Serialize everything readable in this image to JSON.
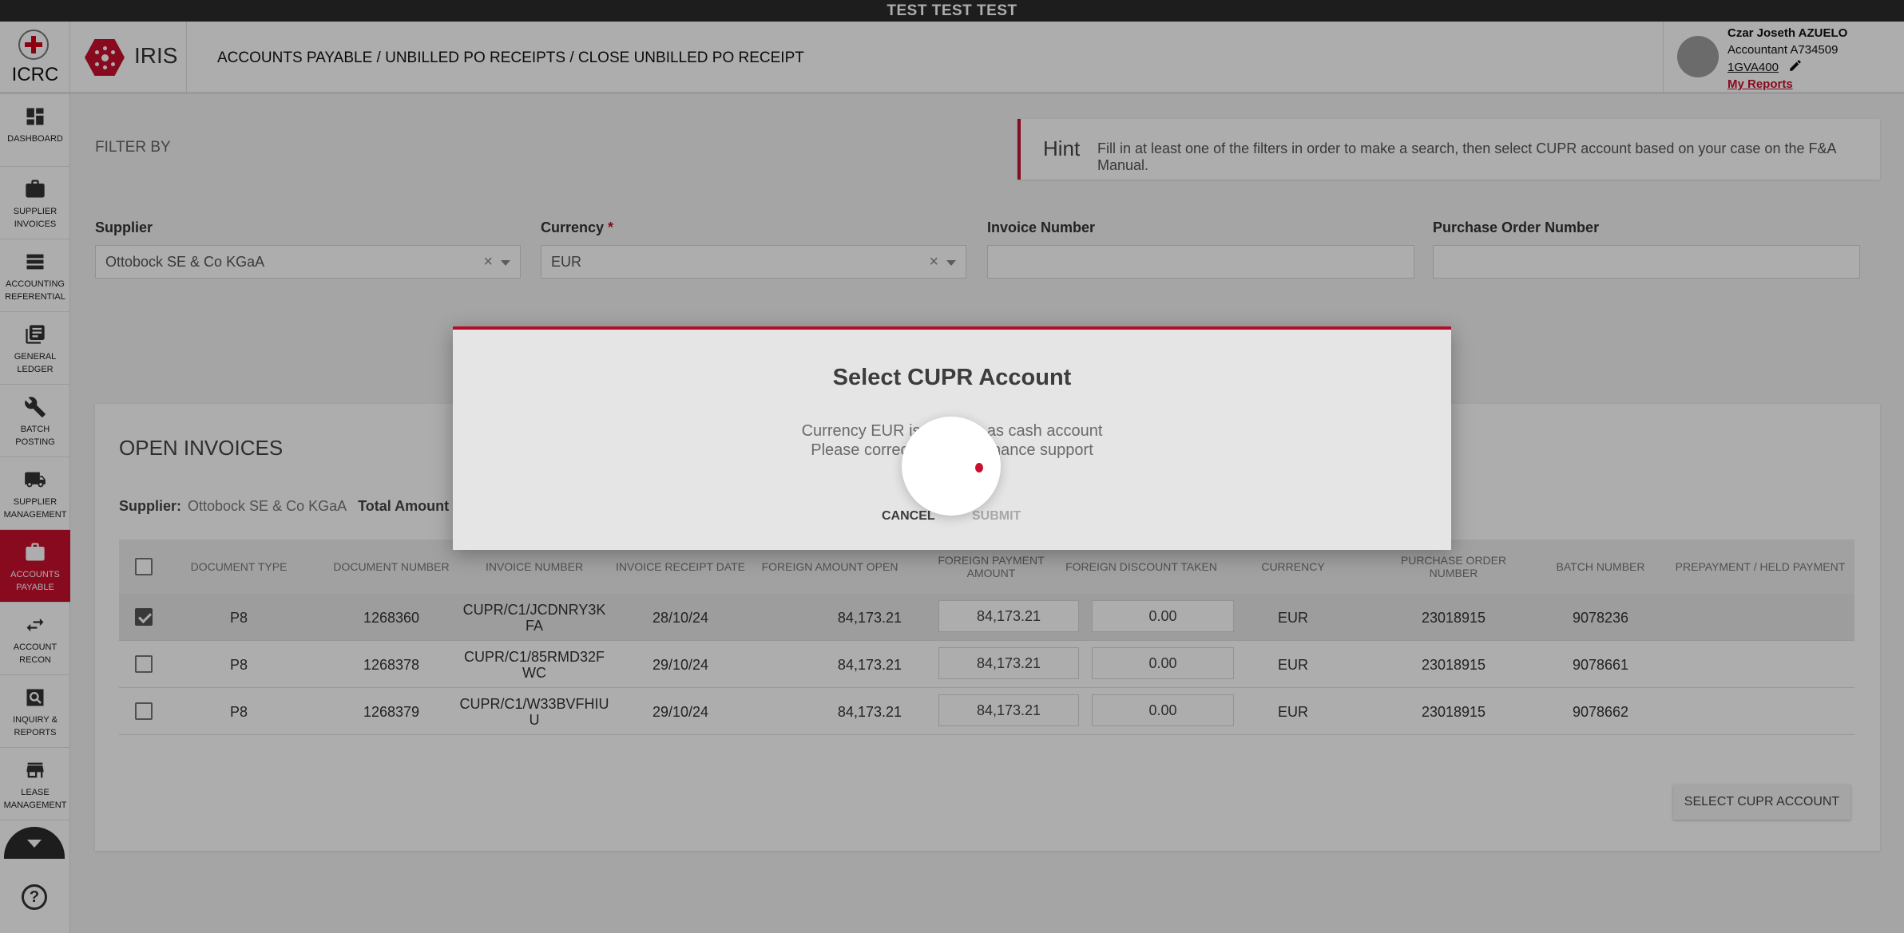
{
  "env_banner": "TEST TEST TEST",
  "header": {
    "logo_text": "ICRC",
    "app_name": "IRIS",
    "breadcrumb": "ACCOUNTS PAYABLE / UNBILLED PO RECEIPTS / CLOSE UNBILLED PO RECEIPT",
    "user": {
      "name": "Czar Joseth AZUELO",
      "role": "Accountant A734509",
      "location_code": "1GVA400",
      "reports_link": "My Reports"
    }
  },
  "sidebar": {
    "items": [
      {
        "label": "Dashboard",
        "icon": "dashboard-icon"
      },
      {
        "label": "Supplier Invoices",
        "icon": "briefcase-icon"
      },
      {
        "label": "Accounting Referential",
        "icon": "list-icon"
      },
      {
        "label": "General Ledger",
        "icon": "ledger-icon"
      },
      {
        "label": "Batch Posting",
        "icon": "wrench-icon"
      },
      {
        "label": "Supplier Management",
        "icon": "truck-icon"
      },
      {
        "label": "Accounts Payable",
        "icon": "briefcase-icon",
        "active": true
      },
      {
        "label": "Account Recon",
        "icon": "swap-icon"
      },
      {
        "label": "Inquiry & Reports",
        "icon": "search-report-icon"
      },
      {
        "label": "Lease Management",
        "icon": "store-icon"
      }
    ],
    "help_icon": "help-icon",
    "help_glyph": "?"
  },
  "filter": {
    "title": "FILTER BY",
    "hint_title": "Hint",
    "hint_text": "Fill in at least one of the filters in order to make a search, then select CUPR account based on your case on the F&A Manual.",
    "supplier_label": "Supplier",
    "supplier_value": "Ottobock SE & Co KGaA",
    "currency_label": "Currency",
    "currency_required": "*",
    "currency_value": "EUR",
    "invoice_label": "Invoice Number",
    "invoice_value": "",
    "po_label": "Purchase Order Number",
    "po_value": ""
  },
  "invoices": {
    "title": "OPEN INVOICES",
    "supplier_label": "Supplier:",
    "supplier_value": "Ottobock SE & Co KGaA",
    "total_label": "Total Amount Se",
    "columns": [
      "Document Type",
      "Document Number",
      "Invoice Number",
      "Invoice Receipt Date",
      "Foreign Amount Open",
      "Foreign Payment Amount",
      "Foreign Discount Taken",
      "Currency",
      "Purchase Order Number",
      "Batch Number",
      "Prepayment / Held Payment"
    ],
    "rows": [
      {
        "checked": true,
        "doc_type": "P8",
        "doc_number": "1268360",
        "invoice_number": "CUPR/C1/JCDNRY3K FA",
        "receipt_date": "28/10/24",
        "amount_open": "84,173.21",
        "payment_amount": "84,173.21",
        "discount_taken": "0.00",
        "currency": "EUR",
        "po_number": "23018915",
        "batch_number": "9078236",
        "prepayment": ""
      },
      {
        "checked": false,
        "doc_type": "P8",
        "doc_number": "1268378",
        "invoice_number": "CUPR/C1/85RMD32F WC",
        "receipt_date": "29/10/24",
        "amount_open": "84,173.21",
        "payment_amount": "84,173.21",
        "discount_taken": "0.00",
        "currency": "EUR",
        "po_number": "23018915",
        "batch_number": "9078661",
        "prepayment": ""
      },
      {
        "checked": false,
        "doc_type": "P8",
        "doc_number": "1268379",
        "invoice_number": "CUPR/C1/W33BVFHIU U",
        "receipt_date": "29/10/24",
        "amount_open": "84,173.21",
        "payment_amount": "84,173.21",
        "discount_taken": "0.00",
        "currency": "EUR",
        "po_number": "23018915",
        "batch_number": "9078662",
        "prepayment": ""
      }
    ],
    "select_button": "SELECT CUPR ACCOUNT"
  },
  "modal": {
    "title": "Select CUPR Account",
    "message_line1": "Currency EUR is               as cash account",
    "message_line2": "Please correct                finance support",
    "cancel_label": "CANCEL",
    "submit_label": "SUBMIT"
  },
  "colors": {
    "brand_red": "#c8102e",
    "dark_bar": "#2b2b2b"
  }
}
